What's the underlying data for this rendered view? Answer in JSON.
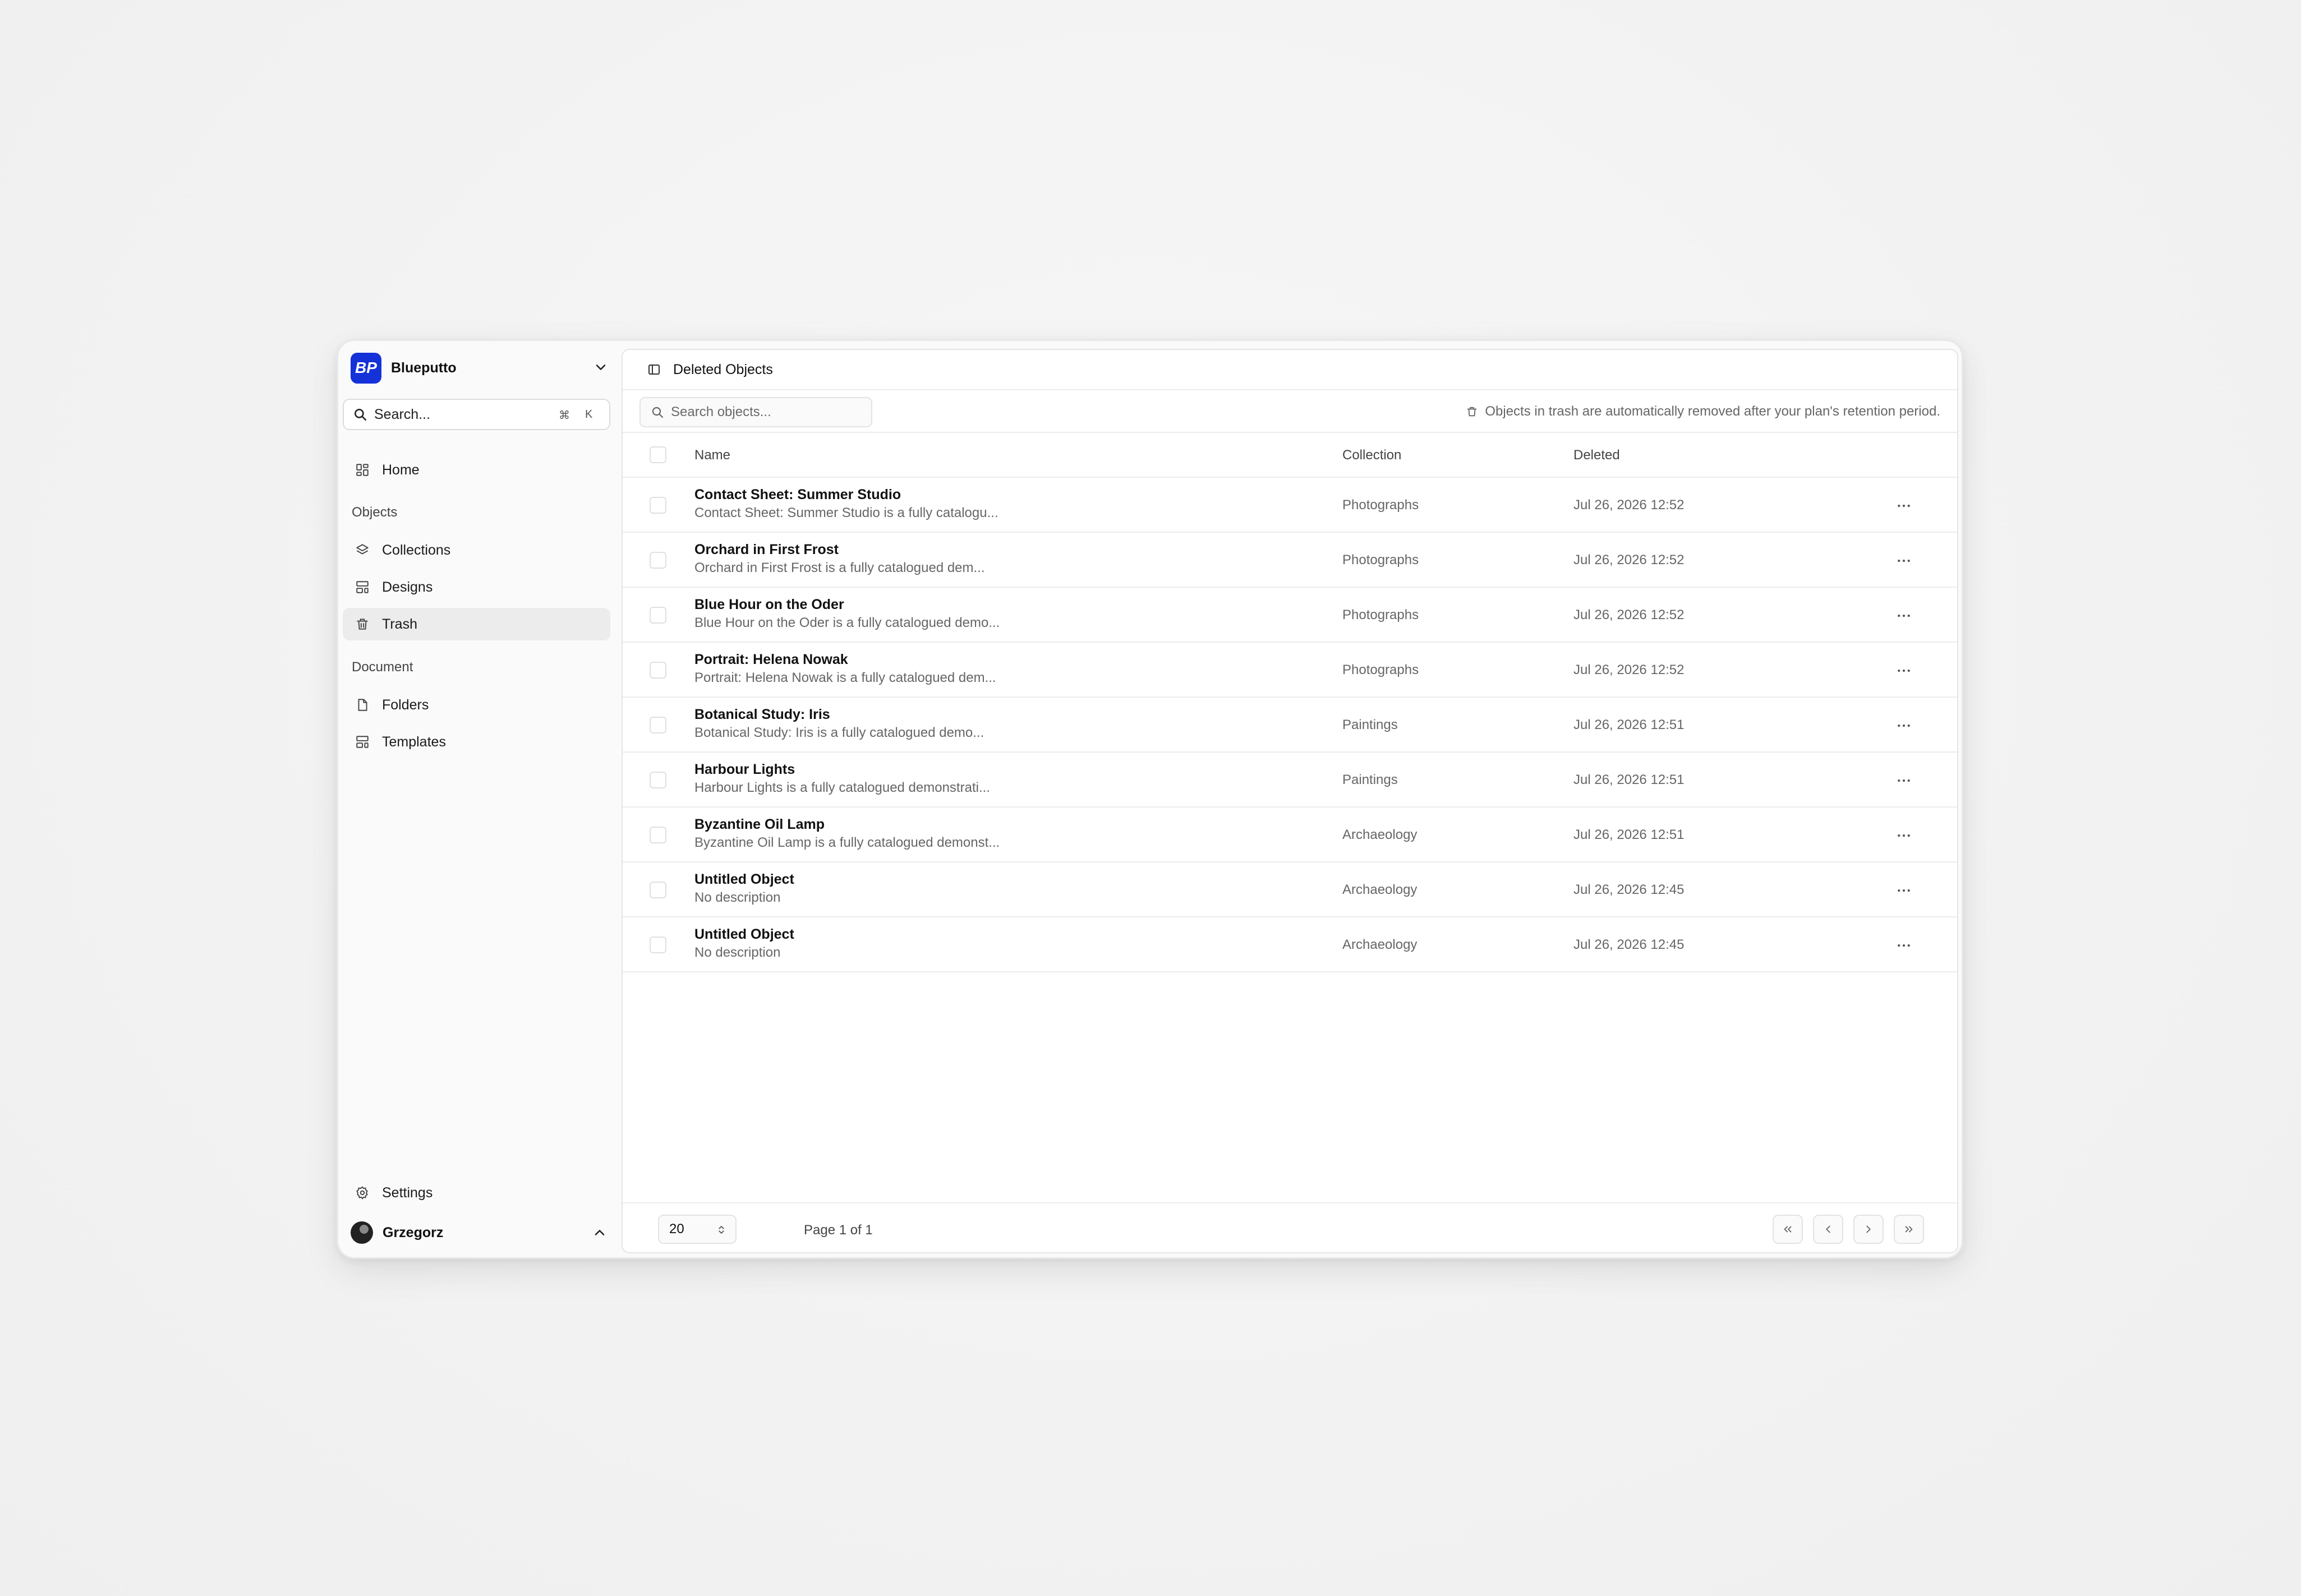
{
  "brand": {
    "name": "Blueputto",
    "logo_text": "BP"
  },
  "sidebar": {
    "search_label": "Search...",
    "search_shortcut": [
      "⌘",
      "K"
    ],
    "home": "Home",
    "section_objects": "Objects",
    "collections": "Collections",
    "designs": "Designs",
    "trash": "Trash",
    "section_document": "Document",
    "folders": "Folders",
    "templates": "Templates",
    "settings": "Settings",
    "user_name": "Grzegorz"
  },
  "header": {
    "title": "Deleted Objects"
  },
  "toolbar": {
    "search_placeholder": "Search objects...",
    "retention_note": "Objects in trash are automatically removed after your plan's retention period."
  },
  "table": {
    "columns": {
      "name": "Name",
      "collection": "Collection",
      "deleted": "Deleted"
    },
    "rows": [
      {
        "name": "Contact Sheet: Summer Studio",
        "desc": "Contact Sheet: Summer Studio is a fully catalogu...",
        "collection": "Photographs",
        "deleted": "Jul 26, 2026 12:52"
      },
      {
        "name": "Orchard in First Frost",
        "desc": "Orchard in First Frost is a fully catalogued dem...",
        "collection": "Photographs",
        "deleted": "Jul 26, 2026 12:52"
      },
      {
        "name": "Blue Hour on the Oder",
        "desc": "Blue Hour on the Oder is a fully catalogued demo...",
        "collection": "Photographs",
        "deleted": "Jul 26, 2026 12:52"
      },
      {
        "name": "Portrait: Helena Nowak",
        "desc": "Portrait: Helena Nowak is a fully catalogued dem...",
        "collection": "Photographs",
        "deleted": "Jul 26, 2026 12:52"
      },
      {
        "name": "Botanical Study: Iris",
        "desc": "Botanical Study: Iris is a fully catalogued demo...",
        "collection": "Paintings",
        "deleted": "Jul 26, 2026 12:51"
      },
      {
        "name": "Harbour Lights",
        "desc": "Harbour Lights is a fully catalogued demonstrati...",
        "collection": "Paintings",
        "deleted": "Jul 26, 2026 12:51"
      },
      {
        "name": "Byzantine Oil Lamp",
        "desc": "Byzantine Oil Lamp is a fully catalogued demonst...",
        "collection": "Archaeology",
        "deleted": "Jul 26, 2026 12:51"
      },
      {
        "name": "Untitled Object",
        "desc": "No description",
        "collection": "Archaeology",
        "deleted": "Jul 26, 2026 12:45"
      },
      {
        "name": "Untitled Object",
        "desc": "No description",
        "collection": "Archaeology",
        "deleted": "Jul 26, 2026 12:45"
      }
    ]
  },
  "pagination": {
    "page_size": "20",
    "page_info": "Page 1 of 1"
  },
  "colors": {
    "brand": "#1432d8",
    "active_nav": "#ececec"
  }
}
